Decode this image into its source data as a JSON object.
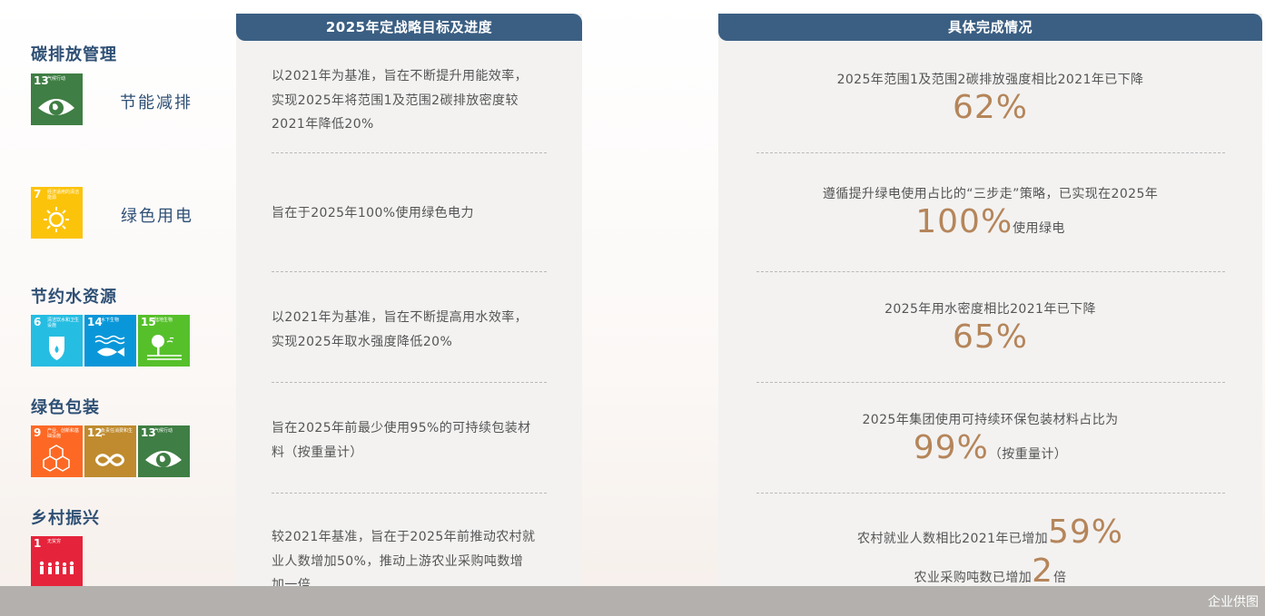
{
  "categories": {
    "carbon": {
      "title": "碳排放管理",
      "label": "节能减排"
    },
    "power": {
      "label": "绿色用电"
    },
    "water": {
      "title": "节约水资源"
    },
    "packaging": {
      "title": "绿色包装"
    },
    "rural": {
      "title": "乡村振兴"
    }
  },
  "sdg_icons": [
    {
      "num": "13",
      "text": "气候行动",
      "color": "#3f7e44",
      "icon": "eye-globe-icon"
    },
    {
      "num": "7",
      "text": "经济适用的清洁能源",
      "color": "#fcc30b",
      "icon": "sun-icon"
    },
    {
      "num": "6",
      "text": "清洁饮水和卫生设施",
      "color": "#26bde2",
      "icon": "water-drop-icon"
    },
    {
      "num": "14",
      "text": "水下生物",
      "color": "#0a97d9",
      "icon": "fish-icon"
    },
    {
      "num": "15",
      "text": "陆地生物",
      "color": "#56c02b",
      "icon": "tree-icon"
    },
    {
      "num": "9",
      "text": "产业、创新和基础设施",
      "color": "#fd6925",
      "icon": "cubes-icon"
    },
    {
      "num": "12",
      "text": "负责任消费和生产",
      "color": "#bf8b2e",
      "icon": "infinity-icon"
    },
    {
      "num": "13",
      "text": "气候行动",
      "color": "#3f7e44",
      "icon": "eye-globe-icon"
    },
    {
      "num": "1",
      "text": "无贫穷",
      "color": "#e5243b",
      "icon": "family-icon"
    }
  ],
  "goals": {
    "header": "2025年定战略目标及进度",
    "items": [
      [
        "以2021年为基准，旨在不断提升用能效率，",
        "实现2025年将范围1及范围2碳排放密度较",
        "2021年降低20%"
      ],
      [
        "旨在于2025年100%使用绿色电力"
      ],
      [
        "以2021年为基准，旨在不断提高用水效率，",
        "实现2025年取水强度降低20%"
      ],
      [
        "旨在2025年前最少使用95%的可持续包装材",
        "料（按重量计）"
      ],
      [
        "较2021年基准，旨在于2025年前推动农村就",
        "业人数增加50%，推动上游农业采购吨数增",
        "加一倍"
      ]
    ]
  },
  "results": {
    "header": "具体完成情况",
    "r1": {
      "text": "2025年范围1及范围2碳排放强度相比2021年已下降",
      "big": "62%"
    },
    "r2": {
      "text": "遵循提升绿电使用占比的“三步走”策略，已实现在2025年",
      "big": "100%",
      "suffix": "使用绿电"
    },
    "r3": {
      "text": "2025年用水密度相比2021年已下降",
      "big": "65%"
    },
    "r4": {
      "text": "2025年集团使用可持续环保包装材料占比为",
      "big": "99%",
      "suffix": "（按重量计）"
    },
    "r5": {
      "text": "农村就业人数相比2021年已增加",
      "big": "59%",
      "text2": "农业采购吨数已增加",
      "big2": "2",
      "suffix2": "倍"
    }
  },
  "footer": {
    "text": "企业供图"
  }
}
